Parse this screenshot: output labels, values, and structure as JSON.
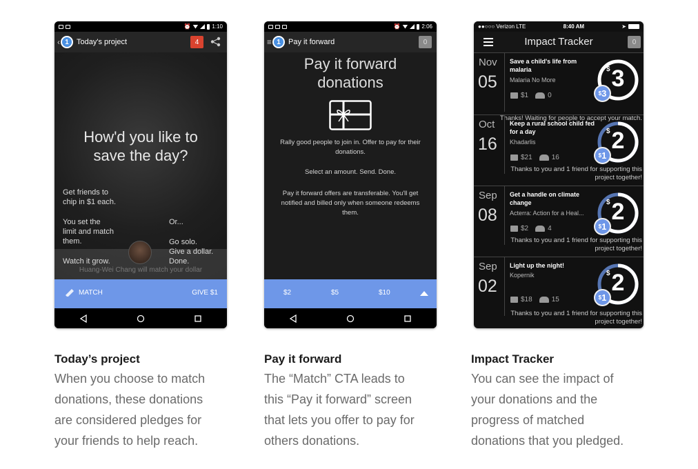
{
  "phone1": {
    "status_time": "1:10",
    "title": "Today's project",
    "badge": "4",
    "headline_line1": "How'd you like to",
    "headline_line2": "save the day?",
    "left_text1_l1": "Get friends to",
    "left_text1_l2": "chip in $1 each.",
    "left_text2_l1": "You set the",
    "left_text2_l2": "limit and match",
    "left_text2_l3": "them.",
    "left_text3": "Watch it grow.",
    "right_or": "Or...",
    "right_l1": "Go solo.",
    "right_l2": "Give a dollar.",
    "right_l3": "Done.",
    "faint_text": "Huang-Wei Chang will match your dollar",
    "match_label": "MATCH",
    "give_label": "GIVE $1"
  },
  "phone2": {
    "status_time": "2:06",
    "title": "Pay it forward",
    "badge": "0",
    "heading_l1": "Pay it forward",
    "heading_l2": "donations",
    "para1": "Rally good people to join in. Offer to pay for their donations.",
    "para2": "Select an amount. Send. Done.",
    "para3": "Pay it forward offers are transferable. You'll get notified and billed only when someone redeems them.",
    "amounts": [
      "$2",
      "$5",
      "$10"
    ]
  },
  "phone3": {
    "carrier": "●●○○○ Verizon  LTE",
    "time": "8:40 AM",
    "title": "Impact Tracker",
    "badge": "0",
    "rows": [
      {
        "month": "Nov",
        "day": "05",
        "title": "Save a child's life from malaria",
        "org": "Malaria No More",
        "gifts": "$1",
        "people": "0",
        "ring": "3",
        "pill": "3",
        "note_l1": "Thanks! Waiting for people to accept your match.",
        "note_l2": ""
      },
      {
        "month": "Oct",
        "day": "16",
        "title": "Keep a rural school child fed for a day",
        "org": "Khadarlis",
        "gifts": "$21",
        "people": "16",
        "ring": "2",
        "pill": "1",
        "note_l1": "Thanks to you and 1 friend for supporting this",
        "note_l2": "project together!"
      },
      {
        "month": "Sep",
        "day": "08",
        "title": "Get a handle on climate change",
        "org": "Acterra: Action for a Heal...",
        "gifts": "$2",
        "people": "4",
        "ring": "2",
        "pill": "1",
        "note_l1": "Thanks to you and 1 friend for supporting this",
        "note_l2": "project together!"
      },
      {
        "month": "Sep",
        "day": "02",
        "title": "Light up the night!",
        "org": "Kopernik",
        "gifts": "$18",
        "people": "15",
        "ring": "2",
        "pill": "1",
        "note_l1": "Thanks to you and 1 friend for supporting this",
        "note_l2": "project together!"
      }
    ]
  },
  "captions": [
    {
      "title": "Today’s project",
      "l1": "When you choose to match",
      "l2": "donations, these donations",
      "l3": "are considered pledges for",
      "l4": "your friends to help reach."
    },
    {
      "title": "Pay it forward",
      "l1": "The “Match” CTA leads to",
      "l2": "this “Pay it forward” screen",
      "l3": "that lets you offer to pay for",
      "l4": "others donations."
    },
    {
      "title": "Impact Tracker",
      "l1": "You can see the impact of",
      "l2": "your donations and the",
      "l3": "progress of matched",
      "l4": "donations that you pledged."
    }
  ],
  "colors": {
    "accent_blue": "#6e97e8",
    "badge_red": "#d9432f",
    "dark_bg": "#1c1c1c"
  }
}
